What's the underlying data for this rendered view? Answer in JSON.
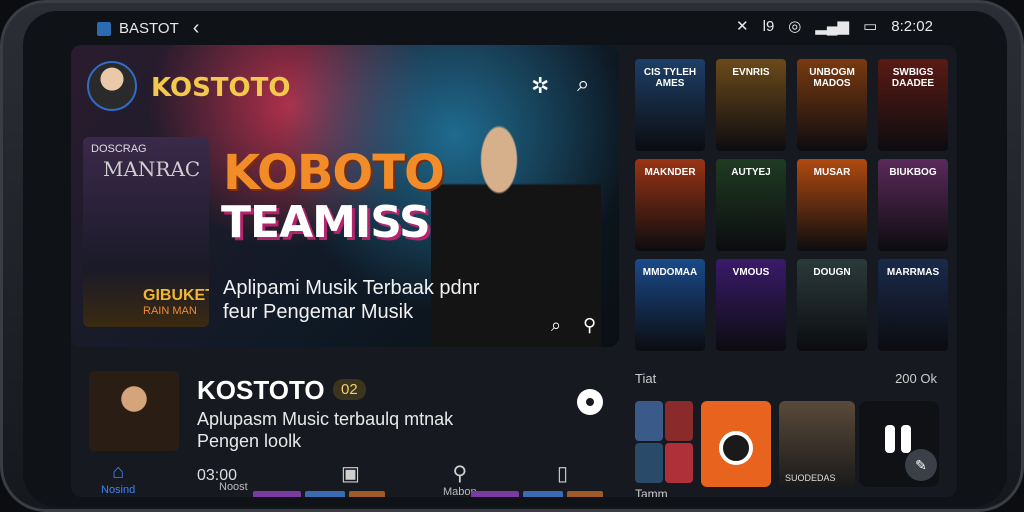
{
  "status": {
    "app": "BASTOT",
    "back": "‹",
    "time": "8:2:02",
    "sig1": "l9"
  },
  "header": {
    "brand": "KOSTOTO"
  },
  "hero": {
    "left_poster_top": "DOSCRAG",
    "left_poster_title": "MANRAC",
    "left_poster_bottom": "GIBUKET",
    "left_poster_bottom2": "RAIN MAN",
    "title_line1": "KOBOTO",
    "title_line2": "TEAMISS",
    "subtitle_line1": "Aplipami Musik Terbaak pdnr",
    "subtitle_line2": "feur Pengemar Musik"
  },
  "grid": {
    "posters": [
      {
        "label": "CIS TYLEH AMES",
        "color": "#1d3f66"
      },
      {
        "label": "EVNRIS",
        "color": "#6b4a1a"
      },
      {
        "label": "UNBOGM MADOS",
        "color": "#7a3a10"
      },
      {
        "label": "SWBIGS DAADEE",
        "color": "#5a1a14"
      },
      {
        "label": "MAKNDER",
        "color": "#9a3414"
      },
      {
        "label": "AUTYEJ",
        "color": "#1f3b22"
      },
      {
        "label": "MUSAR",
        "color": "#b04a10"
      },
      {
        "label": "BIUKBOG",
        "color": "#5a2a5a"
      },
      {
        "label": "MMDOMAA",
        "color": "#1a4a8a"
      },
      {
        "label": "VMOUS",
        "color": "#3a1a6a"
      },
      {
        "label": "DOUGN",
        "color": "#2a3a3a"
      },
      {
        "label": "MARRMAS",
        "color": "#1a2a4a"
      }
    ]
  },
  "now_playing": {
    "title": "KOSTOTO",
    "badge": "02",
    "subtitle_line1": "Aplupasm Music terbaulq mtnak",
    "subtitle_line2": "Pengen loolk",
    "time": "03:00"
  },
  "nav": {
    "home": "Nosind",
    "tab2": "Noost",
    "tab3": "Mabon",
    "tab4": ""
  },
  "section": {
    "label": "Tiat",
    "count": "200 Ok",
    "bottom_label": "Tamm"
  },
  "cards": {
    "middle_caption": "SUODEDAS"
  }
}
